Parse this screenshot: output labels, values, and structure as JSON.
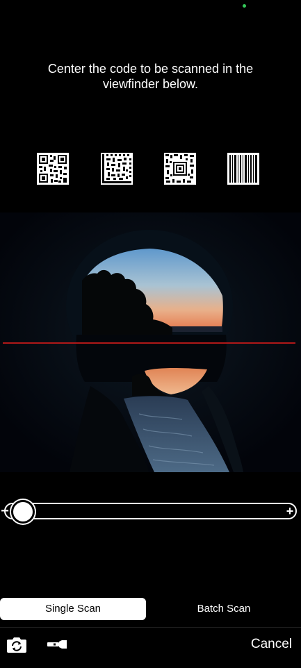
{
  "instruction": {
    "text": "Center the code to be scanned in the viewfinder below."
  },
  "code_types": [
    {
      "icon": "qr-code-icon"
    },
    {
      "icon": "data-matrix-icon"
    },
    {
      "icon": "aztec-code-icon"
    },
    {
      "icon": "barcode-icon"
    }
  ],
  "camera": {
    "scan_line_color": "#b01818"
  },
  "zoom": {
    "minus_label": "−",
    "plus_label": "+",
    "level": 0
  },
  "mode_tabs": {
    "items": [
      {
        "label": "Single Scan",
        "selected": true
      },
      {
        "label": "Batch Scan",
        "selected": false
      }
    ]
  },
  "toolbar": {
    "switch_camera_icon": "switch-camera-icon",
    "flashlight_icon": "flashlight-icon",
    "cancel_label": "Cancel"
  },
  "colors": {
    "background": "#000000",
    "selected_tab": "#ffffff",
    "status_dot": "#34c759"
  }
}
